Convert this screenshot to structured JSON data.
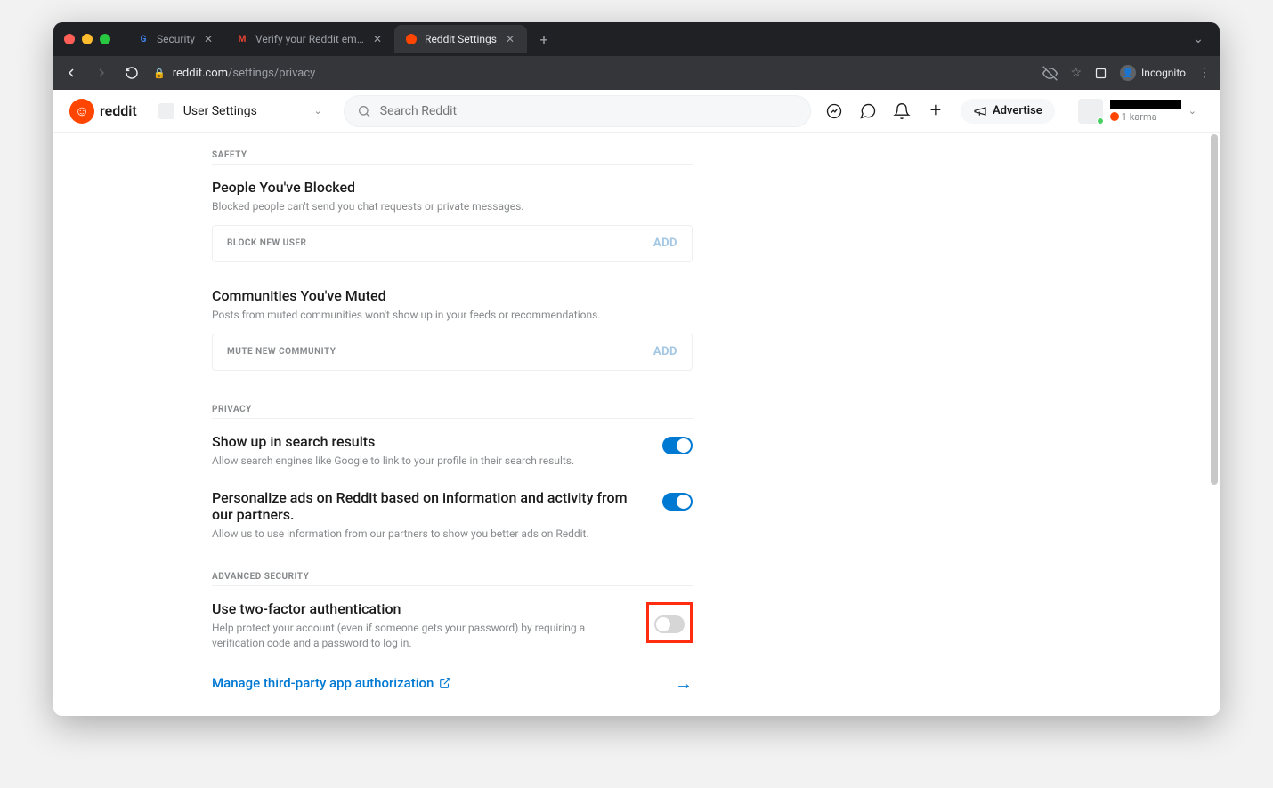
{
  "browser": {
    "tabs": [
      {
        "favicon": "G",
        "label": "Security"
      },
      {
        "favicon": "M",
        "label": "Verify your Reddit email addre"
      },
      {
        "favicon": "R",
        "label": "Reddit Settings"
      }
    ],
    "url_domain": "reddit.com",
    "url_path": "/settings/privacy",
    "incognito_label": "Incognito"
  },
  "header": {
    "logo_text": "reddit",
    "selector": "User Settings",
    "search_placeholder": "Search Reddit",
    "advertise": "Advertise",
    "karma": "1 karma"
  },
  "sections": {
    "safety": {
      "heading": "SAFETY",
      "blocked": {
        "title": "People You've Blocked",
        "desc": "Blocked people can't send you chat requests or private messages.",
        "placeholder": "BLOCK NEW USER",
        "add": "ADD"
      },
      "muted": {
        "title": "Communities You've Muted",
        "desc": "Posts from muted communities won't show up in your feeds or recommendations.",
        "placeholder": "MUTE NEW COMMUNITY",
        "add": "ADD"
      }
    },
    "privacy": {
      "heading": "PRIVACY",
      "search": {
        "title": "Show up in search results",
        "desc": "Allow search engines like Google to link to your profile in their search results."
      },
      "ads": {
        "title": "Personalize ads on Reddit based on information and activity from our partners.",
        "desc": "Allow us to use information from our partners to show you better ads on Reddit."
      }
    },
    "advsec": {
      "heading": "ADVANCED SECURITY",
      "twofa": {
        "title": "Use two-factor authentication",
        "desc": "Help protect your account (even if someone gets your password) by requiring a verification code and a password to log in."
      },
      "manage": "Manage third-party app authorization"
    }
  }
}
